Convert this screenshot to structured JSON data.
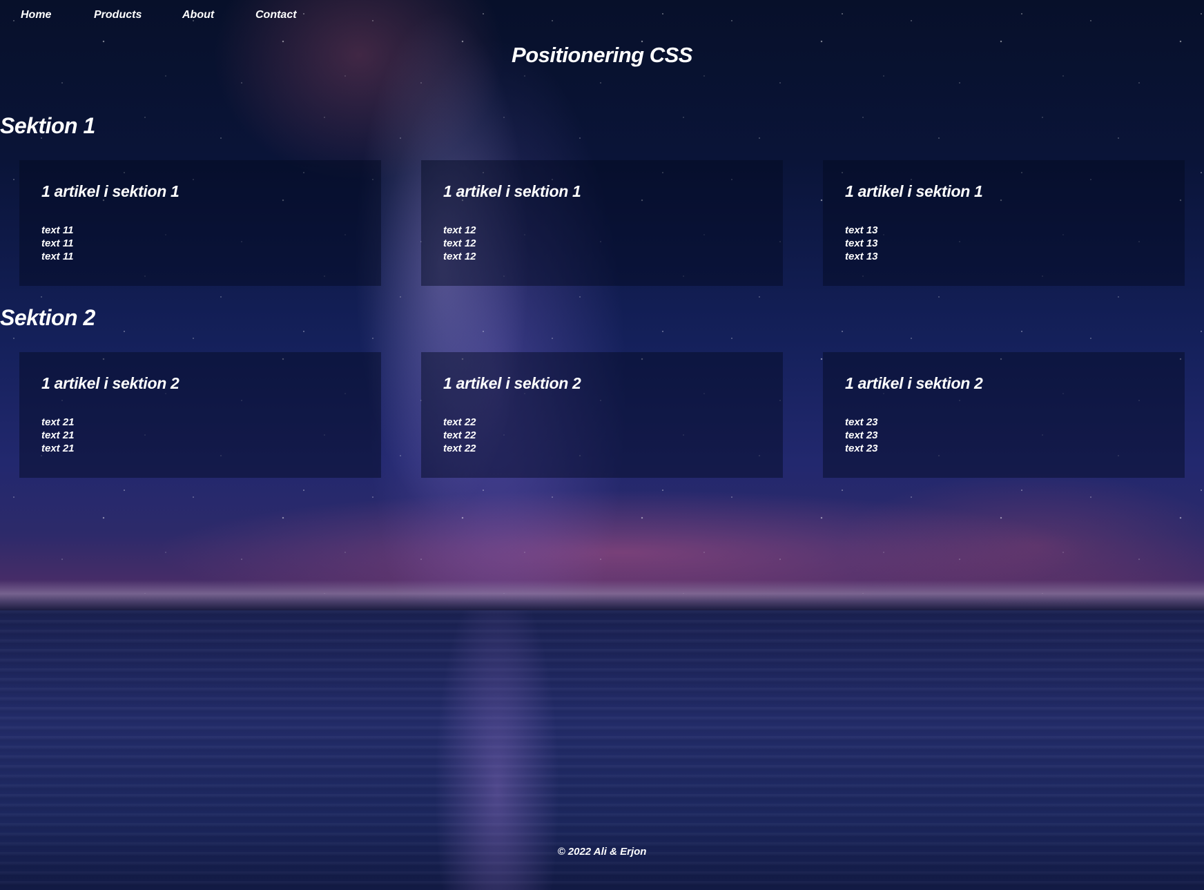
{
  "nav": {
    "items": [
      {
        "label": "Home"
      },
      {
        "label": "Products"
      },
      {
        "label": "About"
      },
      {
        "label": "Contact"
      }
    ]
  },
  "page": {
    "title": "Positionering CSS"
  },
  "sections": [
    {
      "title": "Sektion 1",
      "articles": [
        {
          "heading": "1 artikel i sektion 1",
          "lines": [
            "text 11",
            "text 11",
            "text 11"
          ]
        },
        {
          "heading": "1 artikel i sektion 1",
          "lines": [
            "text 12",
            "text 12",
            "text 12"
          ]
        },
        {
          "heading": "1 artikel i sektion 1",
          "lines": [
            "text 13",
            "text 13",
            "text 13"
          ]
        }
      ]
    },
    {
      "title": "Sektion 2",
      "articles": [
        {
          "heading": "1 artikel i sektion 2",
          "lines": [
            "text 21",
            "text 21",
            "text 21"
          ]
        },
        {
          "heading": "1 artikel i sektion 2",
          "lines": [
            "text 22",
            "text 22",
            "text 22"
          ]
        },
        {
          "heading": "1 artikel i sektion 2",
          "lines": [
            "text 23",
            "text 23",
            "text 23"
          ]
        }
      ]
    }
  ],
  "footer": {
    "text": "© 2022 Ali & Erjon"
  }
}
